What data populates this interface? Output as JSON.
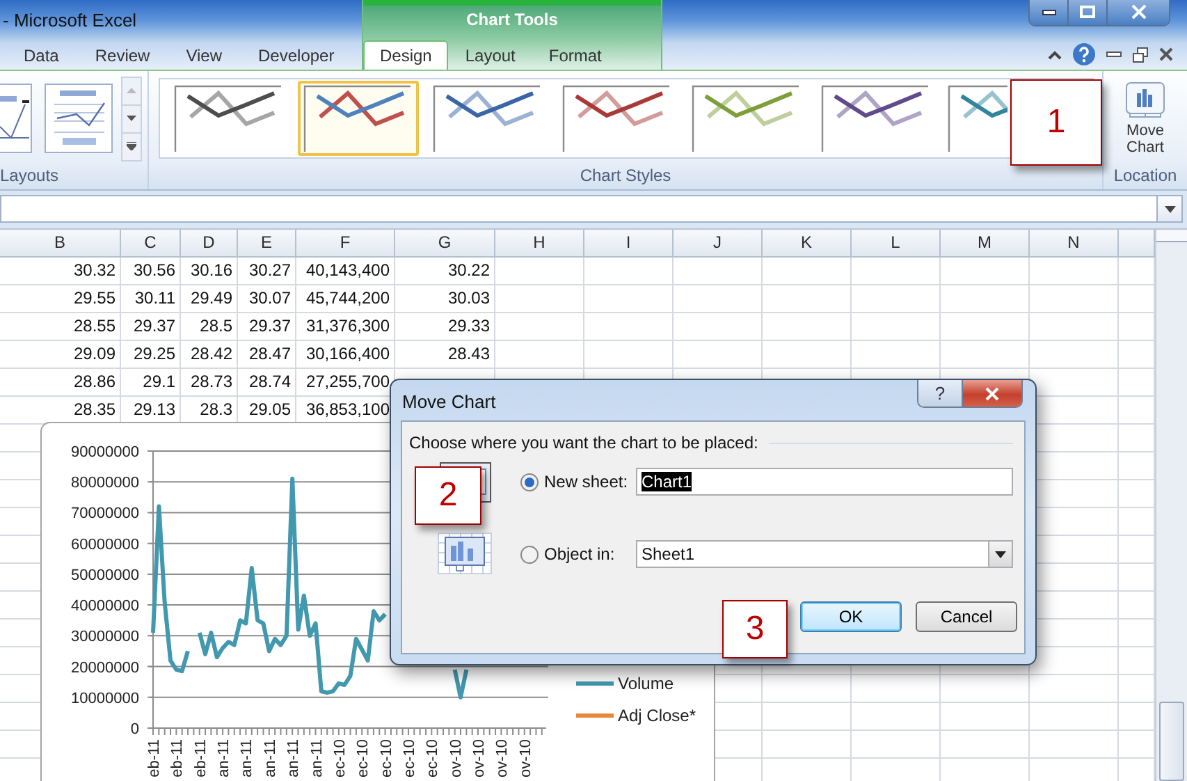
{
  "window": {
    "title": "- Microsoft Excel"
  },
  "tabs": [
    {
      "label": "Data",
      "selected": false
    },
    {
      "label": "Review",
      "selected": false
    },
    {
      "label": "View",
      "selected": false
    },
    {
      "label": "Developer",
      "selected": false
    }
  ],
  "chart_tools": {
    "title": "Chart Tools",
    "tabs": [
      {
        "label": "Design",
        "selected": true
      },
      {
        "label": "Layout",
        "selected": false
      },
      {
        "label": "Format",
        "selected": false
      }
    ]
  },
  "ribbon": {
    "groups": [
      {
        "kind": "layouts",
        "label": "Layouts"
      },
      {
        "kind": "styles",
        "label": "Chart Styles",
        "styles": [
          {
            "kind": "mono",
            "color": "#4d4d4d",
            "selected": false
          },
          {
            "kind": "multi",
            "color": "#4f81bd",
            "selected": true
          },
          {
            "kind": "mono",
            "color": "#3a66a8",
            "selected": false
          },
          {
            "kind": "mono",
            "color": "#a83a37",
            "selected": false
          },
          {
            "kind": "mono",
            "color": "#7e9e3a",
            "selected": false
          },
          {
            "kind": "mono",
            "color": "#5f4a8b",
            "selected": false
          },
          {
            "kind": "mono",
            "color": "#31859c",
            "selected": false
          }
        ]
      },
      {
        "kind": "location",
        "label": "Location",
        "button": "Move Chart"
      }
    ]
  },
  "sheet": {
    "columns": [
      "B",
      "C",
      "D",
      "E",
      "F",
      "G",
      "H",
      "I",
      "J",
      "K",
      "L",
      "M",
      "N"
    ],
    "rows": [
      [
        "30.32",
        "30.56",
        "30.16",
        "30.27",
        "40,143,400",
        "30.22"
      ],
      [
        "29.55",
        "30.11",
        "29.49",
        "30.07",
        "45,744,200",
        "30.03"
      ],
      [
        "28.55",
        "29.37",
        "28.5",
        "29.37",
        "31,376,300",
        "29.33"
      ],
      [
        "29.09",
        "29.25",
        "28.42",
        "28.47",
        "30,166,400",
        "28.43"
      ],
      [
        "28.86",
        "29.1",
        "28.73",
        "28.74",
        "27,255,700"
      ],
      [
        "28.35",
        "29.13",
        "28.3",
        "29.05",
        "36,853,100"
      ]
    ]
  },
  "chart": {
    "chart_data": {
      "type": "line",
      "grid": true,
      "categories": [
        "eb-11",
        null,
        null,
        null,
        "eb-11",
        null,
        null,
        null,
        "eb-11",
        null,
        null,
        null,
        "an-11",
        null,
        null,
        null,
        "an-11",
        null,
        null,
        null,
        "an-11",
        null,
        null,
        null,
        "an-11",
        null,
        null,
        null,
        "an-11",
        null,
        null,
        null,
        "ec-10",
        null,
        null,
        null,
        "ec-10",
        null,
        null,
        null,
        "ec-10",
        null,
        null,
        null,
        "ec-10",
        null,
        null,
        null,
        "ec-10",
        null,
        null,
        null,
        "ov-10",
        null,
        null,
        null,
        "ov-10",
        null,
        null,
        null,
        "ov-10",
        null,
        null,
        null,
        "ov-10",
        null,
        null,
        null
      ],
      "yticks": [
        0,
        10000000,
        20000000,
        30000000,
        40000000,
        50000000,
        60000000,
        70000000,
        80000000,
        90000000
      ],
      "ylim": [
        0,
        90000000
      ],
      "series": [
        {
          "name": "Volume",
          "color": "#4198af",
          "values": [
            31000000,
            72000000,
            41000000,
            22000000,
            19000000,
            18500000,
            25000000,
            null,
            31000000,
            24000000,
            31000000,
            23000000,
            26000000,
            28000000,
            27000000,
            35000000,
            34000000,
            52000000,
            35000000,
            34000000,
            25000000,
            29000000,
            27000000,
            30000000,
            81000000,
            32000000,
            43000000,
            30000000,
            34000000,
            12000000,
            11500000,
            12000000,
            14500000,
            14000000,
            17000000,
            29000000,
            25500000,
            22000000,
            38000000,
            35000000,
            37000000,
            null,
            null,
            null,
            null,
            null,
            null,
            null,
            null,
            null,
            null,
            null,
            19000000,
            10000000,
            19000000,
            null,
            null,
            null,
            null,
            null,
            null,
            null,
            null,
            null,
            null,
            null,
            null,
            null
          ]
        },
        {
          "name": "Adj Close*",
          "color": "#e8873a",
          "values": [
            null,
            null,
            null,
            null,
            null,
            null,
            null,
            null,
            null,
            null,
            null,
            null,
            null,
            null,
            null,
            null,
            null,
            null,
            null,
            null,
            null,
            null,
            null,
            null,
            null,
            null,
            null,
            null,
            null,
            null,
            null,
            null,
            null,
            null,
            null,
            null,
            null,
            null,
            null,
            null,
            null,
            null,
            null,
            null,
            null,
            null,
            null,
            null,
            null,
            null,
            null,
            null,
            null,
            null,
            null,
            null,
            null,
            null,
            null,
            null,
            null,
            null,
            null,
            null,
            null,
            null,
            null,
            null
          ]
        }
      ]
    }
  },
  "dialog": {
    "title": "Move Chart",
    "help": "?",
    "prompt": "Choose where you want the chart to be placed:",
    "options": [
      {
        "kind": "text",
        "label": "New sheet:",
        "selected": true,
        "value": "Chart1",
        "value_selected": true
      },
      {
        "kind": "combo",
        "label": "Object in:",
        "selected": false,
        "value": "Sheet1"
      }
    ],
    "buttons": [
      {
        "label": "OK",
        "default": true
      },
      {
        "label": "Cancel",
        "default": false
      }
    ]
  },
  "callouts": [
    {
      "label": "1"
    },
    {
      "label": "2"
    },
    {
      "label": "3"
    }
  ]
}
